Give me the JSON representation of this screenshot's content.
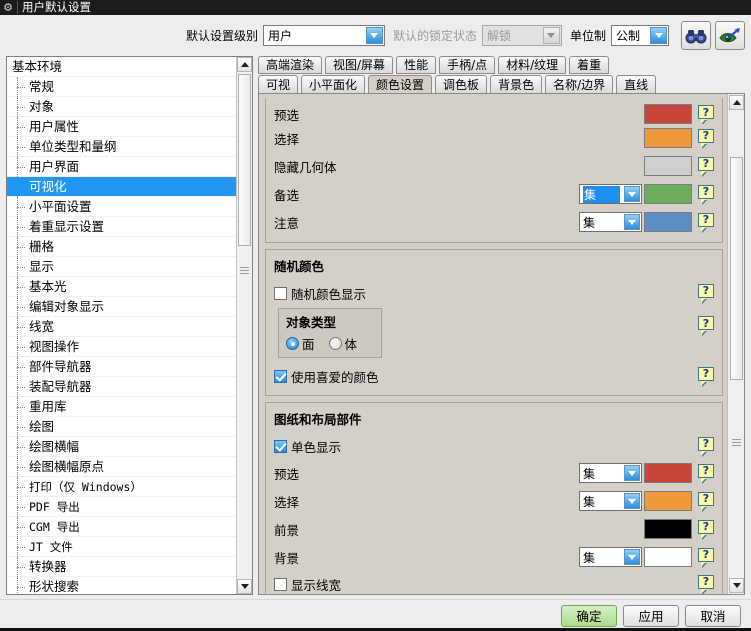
{
  "window": {
    "title": "用户默认设置",
    "icon": "gear-icon"
  },
  "toolbar": {
    "level_label": "默认设置级别",
    "level_value": "用户",
    "lock_label": "默认的锁定状态",
    "lock_value": "解锁",
    "unit_label": "单位制",
    "unit_value": "公制",
    "find_icon": "binoculars-icon",
    "visual_icon": "eye-arrow-icon"
  },
  "sidebar": {
    "root": "基本环境",
    "items": [
      {
        "label": "常规",
        "selected": false,
        "mono": false
      },
      {
        "label": "对象",
        "selected": false,
        "mono": false
      },
      {
        "label": "用户属性",
        "selected": false,
        "mono": false
      },
      {
        "label": "单位类型和量纲",
        "selected": false,
        "mono": false
      },
      {
        "label": "用户界面",
        "selected": false,
        "mono": false
      },
      {
        "label": "可视化",
        "selected": true,
        "mono": false
      },
      {
        "label": "小平面设置",
        "selected": false,
        "mono": false
      },
      {
        "label": "着重显示设置",
        "selected": false,
        "mono": false
      },
      {
        "label": "栅格",
        "selected": false,
        "mono": false
      },
      {
        "label": "显示",
        "selected": false,
        "mono": false
      },
      {
        "label": "基本光",
        "selected": false,
        "mono": false
      },
      {
        "label": "编辑对象显示",
        "selected": false,
        "mono": false
      },
      {
        "label": "线宽",
        "selected": false,
        "mono": false
      },
      {
        "label": "视图操作",
        "selected": false,
        "mono": false
      },
      {
        "label": "部件导航器",
        "selected": false,
        "mono": false
      },
      {
        "label": "装配导航器",
        "selected": false,
        "mono": false
      },
      {
        "label": "重用库",
        "selected": false,
        "mono": false
      },
      {
        "label": "绘图",
        "selected": false,
        "mono": false
      },
      {
        "label": "绘图横幅",
        "selected": false,
        "mono": false
      },
      {
        "label": "绘图横幅原点",
        "selected": false,
        "mono": false
      },
      {
        "label": "打印（仅 Windows）",
        "selected": false,
        "mono": true
      },
      {
        "label": "PDF 导出",
        "selected": false,
        "mono": true
      },
      {
        "label": "CGM 导出",
        "selected": false,
        "mono": true
      },
      {
        "label": "JT 文件",
        "selected": false,
        "mono": true
      },
      {
        "label": "转换器",
        "selected": false,
        "mono": false
      },
      {
        "label": "形状搜索",
        "selected": false,
        "mono": false
      }
    ]
  },
  "tabs": {
    "row1": [
      {
        "label": "高端渲染",
        "active": false
      },
      {
        "label": "视图/屏幕",
        "active": false
      },
      {
        "label": "性能",
        "active": false
      },
      {
        "label": "手柄/点",
        "active": false
      },
      {
        "label": "材料/纹理",
        "active": false
      },
      {
        "label": "着重",
        "active": false
      }
    ],
    "row2": [
      {
        "label": "可视",
        "active": false
      },
      {
        "label": "小平面化",
        "active": false
      },
      {
        "label": "颜色设置",
        "active": true
      },
      {
        "label": "调色板",
        "active": false
      },
      {
        "label": "背景色",
        "active": false
      },
      {
        "label": "名称/边界",
        "active": false
      },
      {
        "label": "直线",
        "active": false
      }
    ]
  },
  "panel": {
    "help_glyph": "?",
    "group_top": {
      "rows": [
        {
          "label": "预选",
          "has_combo": false,
          "combo_value": "",
          "combo_focused": false,
          "swatch": "#c8453c",
          "clipped": true
        },
        {
          "label": "选择",
          "has_combo": false,
          "combo_value": "",
          "combo_focused": false,
          "swatch": "#f0993c",
          "clipped": false
        },
        {
          "label": "隐藏几何体",
          "has_combo": false,
          "combo_value": "",
          "combo_focused": false,
          "swatch": "#cfcfcf",
          "clipped": false
        },
        {
          "label": "备选",
          "has_combo": true,
          "combo_value": "集",
          "combo_focused": true,
          "swatch": "#6cad5d",
          "clipped": false
        },
        {
          "label": "注意",
          "has_combo": true,
          "combo_value": "集",
          "combo_focused": false,
          "swatch": "#5d8fc4",
          "clipped": false
        }
      ]
    },
    "group_random": {
      "title": "随机颜色",
      "show_random": {
        "label": "随机颜色显示",
        "checked": false
      },
      "object_type": {
        "title": "对象类型",
        "options": [
          {
            "label": "面",
            "selected": true
          },
          {
            "label": "体",
            "selected": false
          }
        ]
      },
      "use_favorite": {
        "label": "使用喜爱的颜色",
        "checked": true
      }
    },
    "group_drawing": {
      "title": "图纸和布局部件",
      "mono_display": {
        "label": "单色显示",
        "checked": true
      },
      "rows": [
        {
          "label": "预选",
          "has_combo": true,
          "combo_value": "集",
          "swatch": "#c8453c"
        },
        {
          "label": "选择",
          "has_combo": true,
          "combo_value": "集",
          "swatch": "#f0993c"
        },
        {
          "label": "前景",
          "has_combo": false,
          "combo_value": "",
          "swatch": "#000000"
        },
        {
          "label": "背景",
          "has_combo": true,
          "combo_value": "集",
          "swatch": "#ffffff"
        }
      ],
      "show_linewidth": {
        "label": "显示线宽",
        "checked": false
      }
    }
  },
  "footer": {
    "buttons": [
      {
        "label": "确定",
        "primary": true
      },
      {
        "label": "应用",
        "primary": false
      },
      {
        "label": "取消",
        "primary": false
      }
    ]
  },
  "colors": {
    "accent": "#2196f3",
    "panel_bg": "#d4d0c8",
    "window_bg": "#ededed"
  }
}
